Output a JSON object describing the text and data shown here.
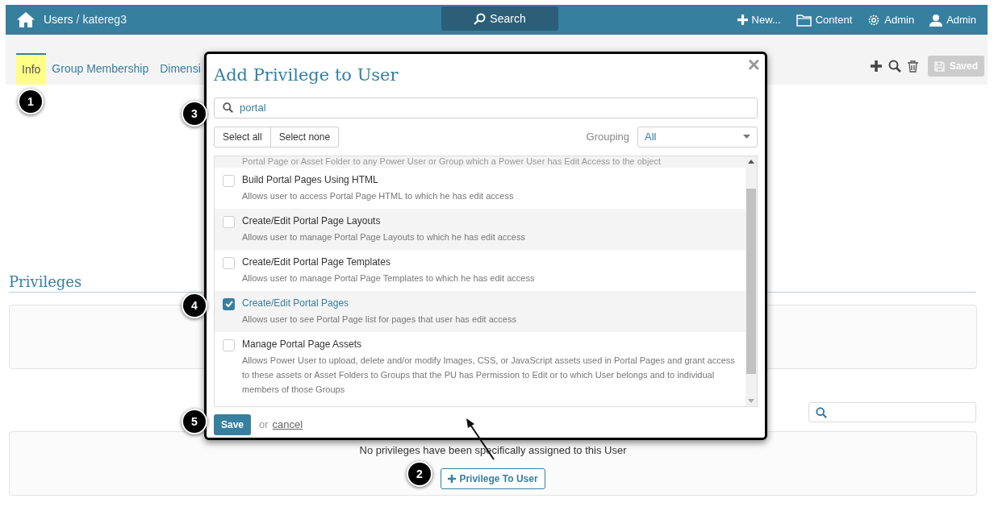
{
  "topbar": {
    "breadcrumb_root": "Users",
    "breadcrumb_separator": "/",
    "breadcrumb_current": "katereg3",
    "search_label": "Search",
    "menu": [
      {
        "kind": "new",
        "label": "New..."
      },
      {
        "kind": "content",
        "label": "Content"
      },
      {
        "kind": "admin",
        "label": "Admin"
      },
      {
        "kind": "user",
        "label": "Admin"
      }
    ]
  },
  "tabs": [
    {
      "label": "Info",
      "selected": true
    },
    {
      "label": "Group Membership",
      "selected": false
    },
    {
      "label": "Dimensi",
      "selected": false
    }
  ],
  "toolbar": {
    "saved_label": "Saved",
    "saved_disabled": true
  },
  "privileges": {
    "heading": "Privileges",
    "empty_message": "No privileges have been specifically assigned to this User",
    "add_button": "Privilege To User"
  },
  "modal": {
    "title": "Add Privilege to User",
    "close": "×",
    "search_value": "portal",
    "select_all": "Select all",
    "select_none": "Select none",
    "grouping_label": "Grouping",
    "grouping_value": "All",
    "cut_line": "Portal Page or Asset Folder to any Power User or Group which a Power User has Edit Access to the object",
    "items": [
      {
        "title": "Build Portal Pages Using HTML",
        "description": "Allows user to access Portal Page HTML to which he has edit access",
        "checked": false
      },
      {
        "title": "Create/Edit Portal Page Layouts",
        "description": "Allows user to manage Portal Page Layouts to which he has edit access",
        "checked": false
      },
      {
        "title": "Create/Edit Portal Page Templates",
        "description": "Allows user to manage Portal Page Templates to which he has edit access",
        "checked": false
      },
      {
        "title": "Create/Edit Portal Pages",
        "description": "Allows user to see Portal Page list for pages that user has edit access",
        "checked": true
      },
      {
        "title": "Manage Portal Page Assets",
        "description": "Allows Power User to upload, delete and/or modify Images, CSS, or JavaScript assets used in Portal Pages and grant access to these assets or Asset Folders to Groups that the PU has Permission to Edit or to which User belongs and to individual members of those Groups",
        "checked": false
      }
    ],
    "save": "Save",
    "or": "or",
    "cancel": "cancel"
  },
  "callouts": [
    "1",
    "2",
    "3",
    "4",
    "5"
  ]
}
